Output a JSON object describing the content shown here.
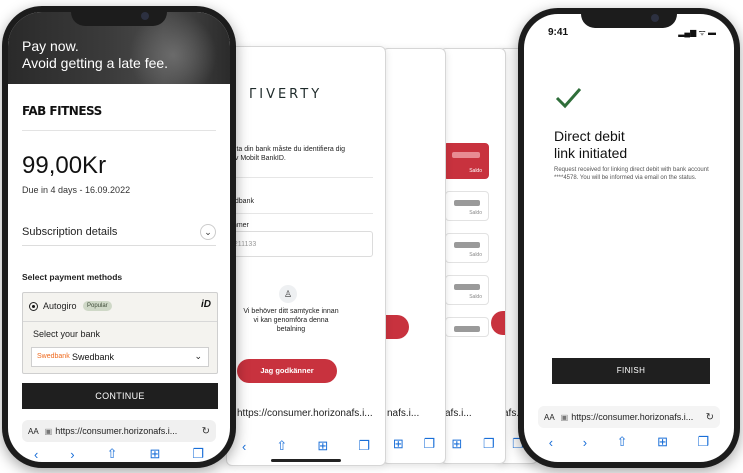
{
  "left_phone": {
    "hero_line1": "Pay now.",
    "hero_line2": "Avoid getting a late fee.",
    "brand": "FAB FITNESS",
    "amount": "99,00Kr",
    "due": "Due in 4 days - 16.09.2022",
    "subscription_details": "Subscription details",
    "select_payment_methods": "Select payment methods",
    "method_autogiro": "Autogiro",
    "popular_badge": "Popular",
    "bankid_logo": "iD",
    "select_your_bank": "Select your bank",
    "bank_logo_text": "Swedbank",
    "bank_selected": "Swedbank",
    "continue_label": "CONTINUE",
    "aa": "AA",
    "url": "https://consumer.horizonafs.i..."
  },
  "riverty_card": {
    "logo": "ΓIVERTY",
    "heading_fragment": "n",
    "text_1": "luta din bank måste du identifiera dig",
    "text_2": "av Mobilt BankID.",
    "bank_label": "k",
    "bank_value": "edbank",
    "number_label": "mmer",
    "number_placeholder": "9211133",
    "consent_line1": "Vi behöver ditt samtycke innan",
    "consent_line2": "vi kan genomföra denna",
    "consent_line3": "betalning",
    "approve_button": "Jag godkänner",
    "url": "https://consumer.horizonafs.i..."
  },
  "back_cards": {
    "saldo": "Saldo",
    "url_a": "nafs.i...",
    "url_b": "afs.i...",
    "url_c": "afs.i..."
  },
  "right_phone": {
    "time": "9:41",
    "status_icons": "▂▄▆ ᯤ ▬",
    "title_line1": "Direct debit",
    "title_line2": "link initiated",
    "description": "Request received for linking direct debit with bank account ****4578. You will be informed via email on the status.",
    "finish_label": "FINISH",
    "aa": "AA",
    "url": "https://consumer.horizonafs.i..."
  },
  "icons": {
    "back": "‹",
    "forward": "›",
    "share": "⇧",
    "bookmarks": "⊞",
    "tabs": "❐",
    "reload": "↻",
    "lock": "🔒",
    "chevron": "⌄"
  },
  "colors": {
    "accent_red": "#c8323e",
    "dark_button": "#1f1f1f",
    "safari_blue": "#1a6fd8",
    "check_green": "#2f6e3a"
  }
}
